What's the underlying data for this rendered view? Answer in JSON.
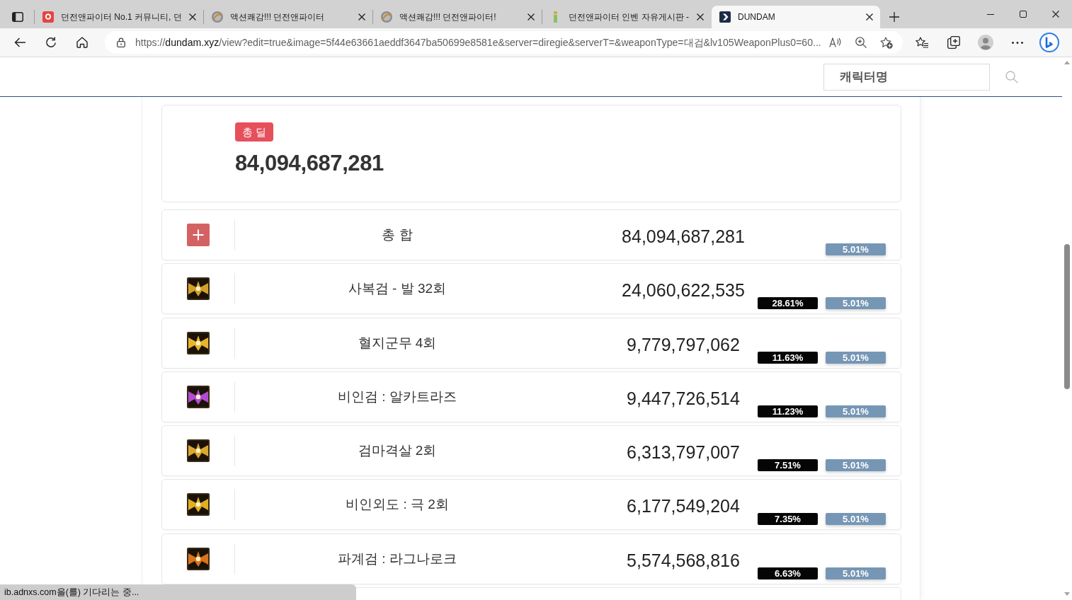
{
  "browser": {
    "tabs": [
      {
        "title": "던전앤파이터 No.1 커뮤니티, 던",
        "selected": false
      },
      {
        "title": "액션쾌감!!! 던전앤파이터",
        "selected": false
      },
      {
        "title": "액션쾌감!!! 던전앤파이터!",
        "selected": false
      },
      {
        "title": "던전앤파이터 인벤 자유게시판 -",
        "selected": false
      },
      {
        "title": "DUNDAM",
        "selected": true
      }
    ],
    "address_bar": {
      "scheme": "https://",
      "host": "dundam.xyz",
      "path": "/view?edit=true&image=5f44e63661aeddf3647ba50699e8581e&server=diregie&serverT=&weaponType=대검&lv105WeaponPlus0=60..."
    },
    "status_text": "ib.adnxs.com을(를) 기다리는 중..."
  },
  "header": {
    "search": {
      "placeholder": "캐릭터명"
    }
  },
  "summary": {
    "label": "총 딜",
    "value": "84,094,687,281"
  },
  "rows": [
    {
      "kind": "total",
      "name": "총 합",
      "damage": "84,094,687,281",
      "second_badge": "5.01%"
    },
    {
      "kind": "skill",
      "color": "#d2a02a",
      "name": "사복검 - 발 32회",
      "damage": "24,060,622,535",
      "share_badge": "28.61%",
      "second_badge": "5.01%"
    },
    {
      "kind": "skill",
      "color": "#e6b52c",
      "name": "혈지군무 4회",
      "damage": "9,779,797,062",
      "share_badge": "11.63%",
      "second_badge": "5.01%"
    },
    {
      "kind": "skill",
      "color": "#b44ad2",
      "name": "비인검 : 알카트라즈",
      "damage": "9,447,726,514",
      "share_badge": "11.23%",
      "second_badge": "5.01%"
    },
    {
      "kind": "skill",
      "color": "#d9a630",
      "name": "검마격살 2회",
      "damage": "6,313,797,007",
      "share_badge": "7.51%",
      "second_badge": "5.01%"
    },
    {
      "kind": "skill",
      "color": "#e2ae22",
      "name": "비인외도 : 극 2회",
      "damage": "6,177,549,204",
      "share_badge": "7.35%",
      "second_badge": "5.01%"
    },
    {
      "kind": "skill",
      "color": "#d8741c",
      "name": "파계검 : 라그나로크",
      "damage": "5,574,568,816",
      "share_badge": "6.63%",
      "second_badge": "5.01%"
    }
  ]
}
